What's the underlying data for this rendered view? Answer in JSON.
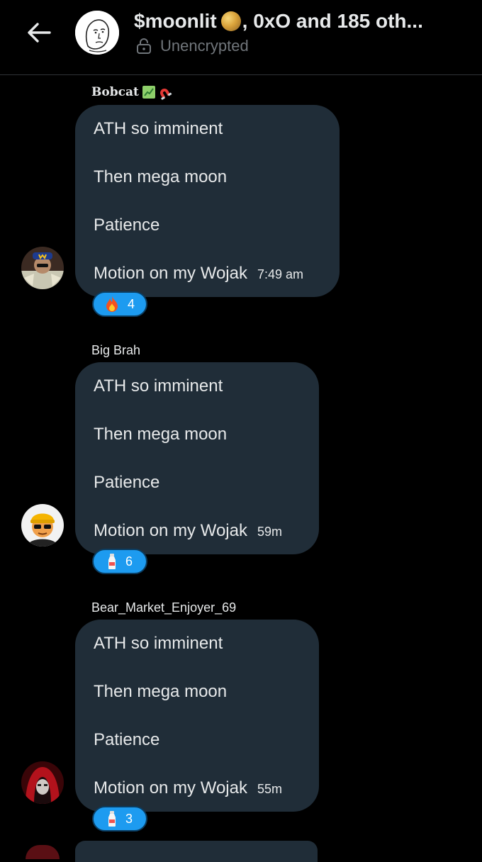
{
  "header": {
    "title_prefix": "$moonlit",
    "title_suffix": ", 0xO and 185 oth...",
    "title_emoji": "moon-emoji",
    "encryption_status": "Unencrypted",
    "back_icon": "arrow-left-icon",
    "lock_icon": "lock-open-icon"
  },
  "messages": [
    {
      "sender": "Bobcat",
      "sender_emoji": "chart-and-magnet-emoji",
      "lines": [
        "ATH so imminent",
        "Then mega moon",
        "Patience",
        "Motion on my Wojak"
      ],
      "timestamp": "7:49 am",
      "reaction": {
        "emoji": "fire-emoji",
        "count": "4"
      }
    },
    {
      "sender": "Big Brah",
      "lines": [
        "ATH so imminent",
        "Then mega moon",
        "Patience",
        "Motion on my Wojak"
      ],
      "timestamp": "59m",
      "reaction": {
        "emoji": "milk-bottle-emoji",
        "count": "6"
      }
    },
    {
      "sender": "Bear_Market_Enjoyer_69",
      "lines": [
        "ATH so imminent",
        "Then mega moon",
        "Patience",
        "Motion on my Wojak"
      ],
      "timestamp": "55m",
      "reaction": {
        "emoji": "milk-bottle-emoji",
        "count": "3"
      }
    }
  ],
  "colors": {
    "background": "#000000",
    "bubble": "#202d38",
    "reaction": "#1d9bf0",
    "muted_text": "#71767b"
  }
}
